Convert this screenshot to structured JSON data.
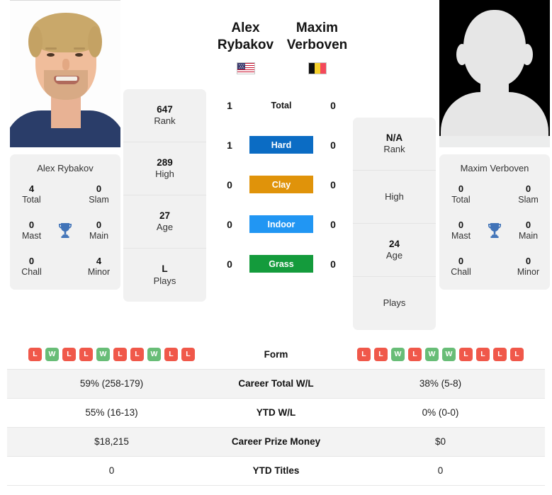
{
  "players": {
    "left": {
      "name": "Alex Rybakov",
      "flag": "us-flag",
      "photo": "player-photo",
      "card_name": "Alex Rybakov",
      "rank": "647",
      "rank_label": "Rank",
      "high": "289",
      "high_label": "High",
      "age": "27",
      "age_label": "Age",
      "plays": "L",
      "plays_label": "Plays",
      "titles": {
        "total": "4",
        "total_label": "Total",
        "slam": "0",
        "slam_label": "Slam",
        "mast": "0",
        "mast_label": "Mast",
        "main": "0",
        "main_label": "Main",
        "chall": "0",
        "chall_label": "Chall",
        "minor": "4",
        "minor_label": "Minor"
      },
      "surface_wins": {
        "total": "1",
        "hard": "1",
        "clay": "0",
        "indoor": "0",
        "grass": "0"
      },
      "form": [
        "L",
        "W",
        "L",
        "L",
        "W",
        "L",
        "L",
        "W",
        "L",
        "L"
      ],
      "career_total_wl": "59% (258-179)",
      "ytd_wl": "55% (16-13)",
      "career_prize_money": "$18,215",
      "ytd_titles": "0"
    },
    "right": {
      "name": "Maxim Verboven",
      "flag": "be-flag",
      "photo": "player-photo-placeholder",
      "card_name": "Maxim Verboven",
      "rank": "N/A",
      "rank_label": "Rank",
      "high": "",
      "high_label": "High",
      "age": "24",
      "age_label": "Age",
      "plays": "",
      "plays_label": "Plays",
      "titles": {
        "total": "0",
        "total_label": "Total",
        "slam": "0",
        "slam_label": "Slam",
        "mast": "0",
        "mast_label": "Mast",
        "main": "0",
        "main_label": "Main",
        "chall": "0",
        "chall_label": "Chall",
        "minor": "0",
        "minor_label": "Minor"
      },
      "surface_wins": {
        "total": "0",
        "hard": "0",
        "clay": "0",
        "indoor": "0",
        "grass": "0"
      },
      "form": [
        "L",
        "L",
        "W",
        "L",
        "W",
        "W",
        "L",
        "L",
        "L",
        "L"
      ],
      "career_total_wl": "38% (5-8)",
      "ytd_wl": "0% (0-0)",
      "career_prize_money": "$0",
      "ytd_titles": "0"
    }
  },
  "surfaces": [
    {
      "key": "total",
      "label": "Total",
      "color": "transparent",
      "text_color": "#141414"
    },
    {
      "key": "hard",
      "label": "Hard",
      "color": "#0b6cc4",
      "text_color": "#ffffff"
    },
    {
      "key": "clay",
      "label": "Clay",
      "color": "#e0930a",
      "text_color": "#ffffff"
    },
    {
      "key": "indoor",
      "label": "Indoor",
      "color": "#2196f3",
      "text_color": "#ffffff"
    },
    {
      "key": "grass",
      "label": "Grass",
      "color": "#149b3c",
      "text_color": "#ffffff"
    }
  ],
  "table_rows": [
    {
      "label": "Form",
      "key": "form"
    },
    {
      "label": "Career Total W/L",
      "key": "career_total_wl"
    },
    {
      "label": "YTD W/L",
      "key": "ytd_wl"
    },
    {
      "label": "Career Prize Money",
      "key": "career_prize_money"
    },
    {
      "label": "YTD Titles",
      "key": "ytd_titles"
    }
  ],
  "colors": {
    "win_badge": "#68bd77",
    "loss_badge": "#f0584a",
    "card_bg": "#f1f1f1",
    "row_alt": "#f3f3f3",
    "trophy": "#4073b8"
  },
  "icons": {
    "trophy": "trophy-icon"
  }
}
